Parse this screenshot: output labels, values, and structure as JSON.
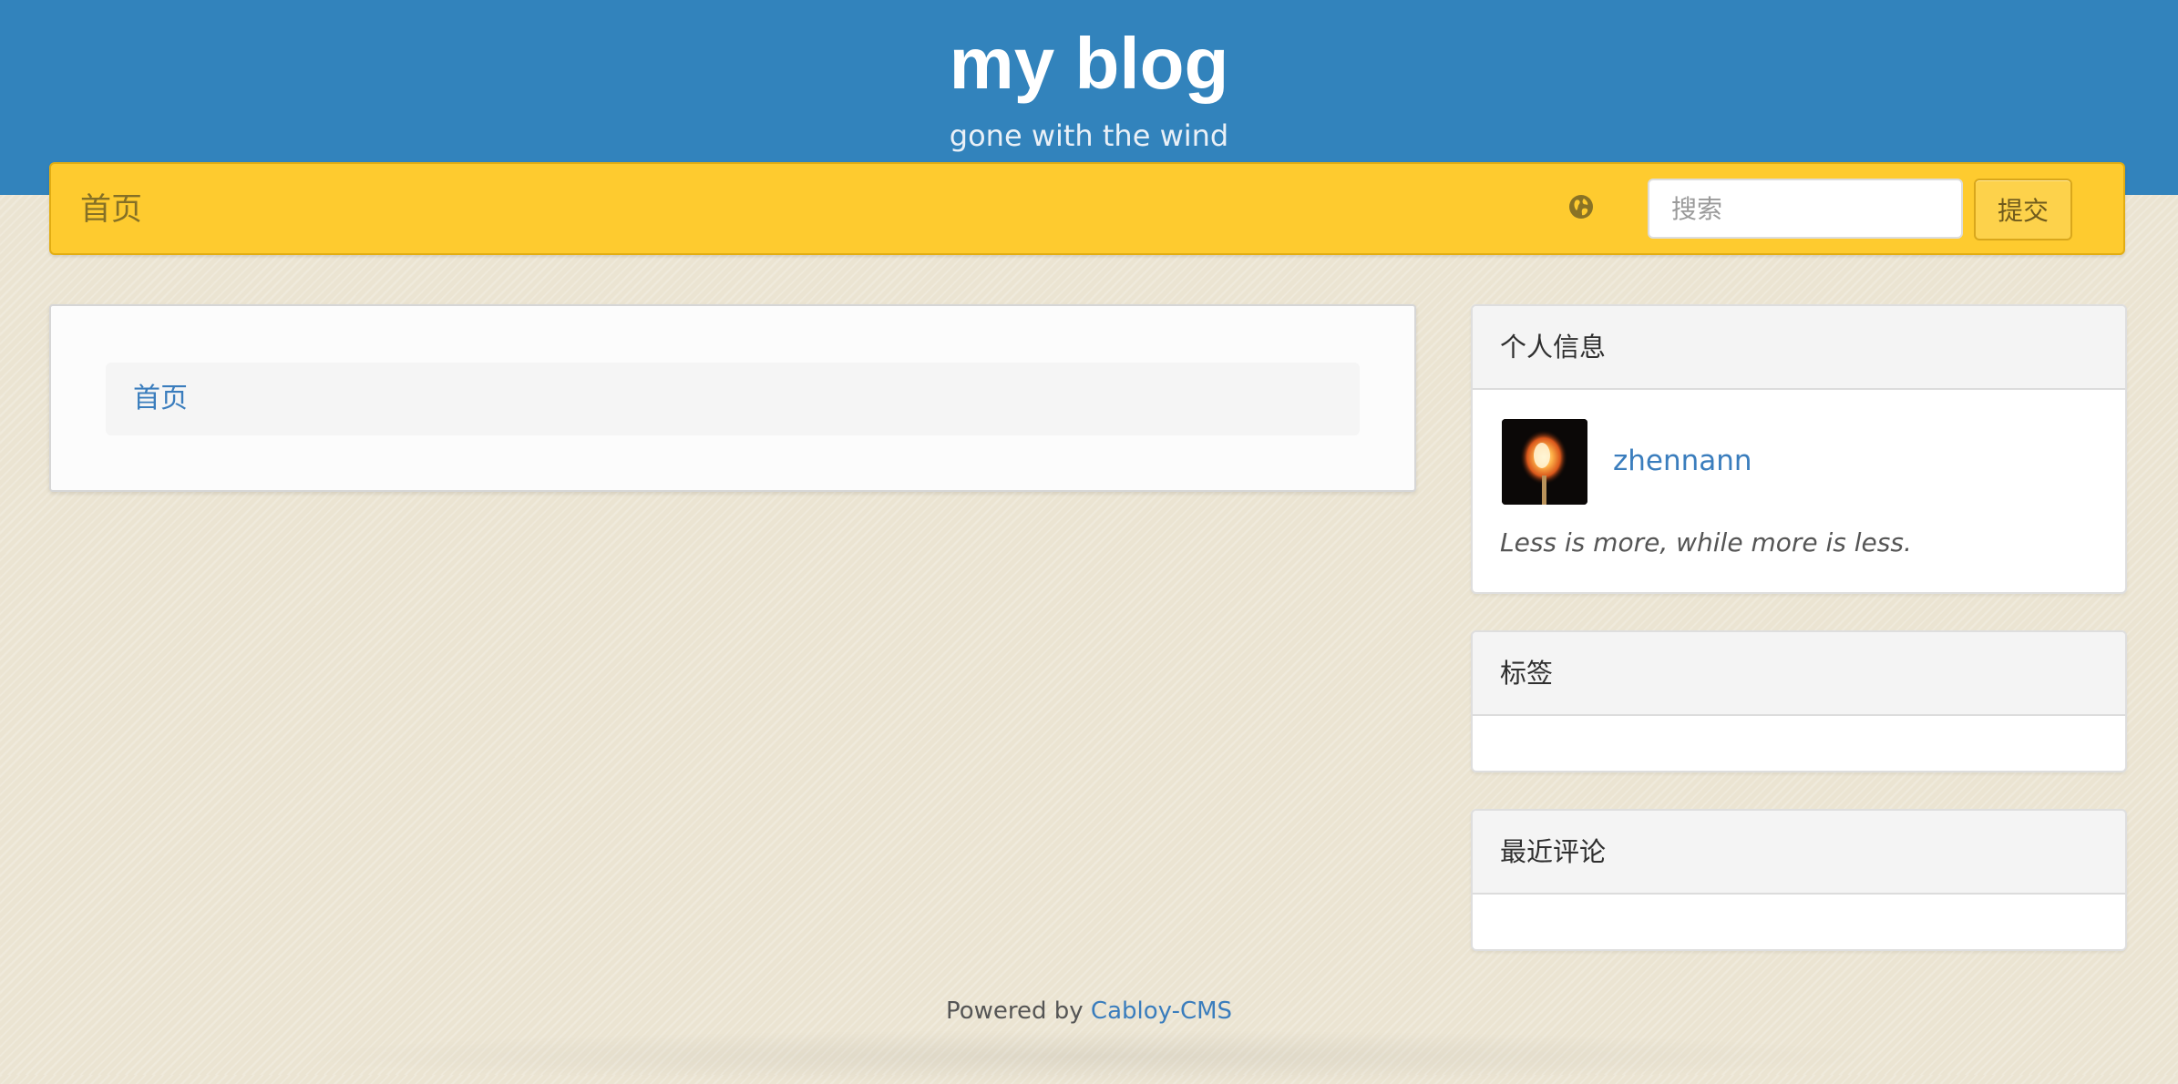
{
  "header": {
    "title": "my blog",
    "subtitle": "gone with the wind"
  },
  "navbar": {
    "home_label": "首页",
    "language_icon": "globe-icon",
    "search_placeholder": "搜索",
    "submit_label": "提交",
    "background_color": "#fecb2f"
  },
  "main": {
    "breadcrumb_home": "首页"
  },
  "sidebar": {
    "profile": {
      "title": "个人信息",
      "username": "zhennann",
      "motto": "Less is more, while more is less."
    },
    "tags": {
      "title": "标签"
    },
    "recent_comments": {
      "title": "最近评论"
    }
  },
  "footer": {
    "powered_prefix": "Powered by",
    "powered_link": "Cabloy-CMS"
  },
  "colors": {
    "header_blue": "#3283bc",
    "link_blue": "#3a7dbd",
    "page_background": "#ebe4d2"
  }
}
